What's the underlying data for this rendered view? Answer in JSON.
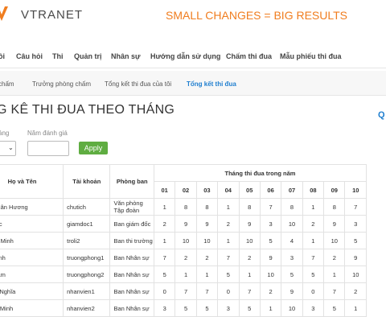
{
  "header": {
    "brand": "VTRANET",
    "slogan": "SMALL CHANGES = BIG RESULTS",
    "logo_color": "#f07d1f"
  },
  "nav": {
    "items": [
      "ồi",
      "Câu hỏi",
      "Thi",
      "Quản trị",
      "Nhân sự",
      "Hướng dẫn sử dụng",
      "Chấm thi đua",
      "Mẫu phiếu thi đua"
    ]
  },
  "subnav": {
    "items": [
      "chấm",
      "Trưởng phòng chấm",
      "Tổng kết thi đua của tôi",
      "Tổng kết thi đua"
    ],
    "active_index": 3,
    "active_color": "#1e7ecf"
  },
  "page": {
    "title": "G KÊ THI ĐUA THEO THÁNG",
    "search_icon": "Q"
  },
  "filters": {
    "month_label": "áng",
    "year_label": "Năm đánh giá",
    "month_select_icon": "chevron-down-icon",
    "year_value": "",
    "apply_label": "Apply",
    "apply_color": "#5fad41"
  },
  "table": {
    "col_name": "Họ và Tên",
    "col_account": "Tài khoản",
    "col_dept": "Phòng ban",
    "col_months_group": "Tháng thi đua trong năm",
    "months": [
      "01",
      "02",
      "03",
      "04",
      "05",
      "06",
      "07",
      "08",
      "09",
      "10"
    ],
    "rows": [
      {
        "name": "ần Xuân Hương",
        "account": "chutich",
        "dept": "Văn phòng Tập đoàn",
        "scores": [
          "1",
          "8",
          "8",
          "1",
          "8",
          "7",
          "8",
          "1",
          "8",
          "7"
        ]
      },
      {
        "name": "ì Ngọc",
        "account": "giamdoc1",
        "dept": "Ban giám đốc",
        "scores": [
          "2",
          "9",
          "9",
          "2",
          "9",
          "3",
          "10",
          "2",
          "9",
          "3"
        ]
      },
      {
        "name": "Ngọc Minh",
        "account": "troli2",
        "dept": "Ban thi trường",
        "scores": [
          "1",
          "10",
          "10",
          "1",
          "10",
          "5",
          "4",
          "1",
          "10",
          "5"
        ]
      },
      {
        "name": "ão Bình",
        "account": "truongphong1",
        "dept": "Ban Nhân sự",
        "scores": [
          "7",
          "2",
          "2",
          "7",
          "2",
          "9",
          "3",
          "7",
          "2",
          "9"
        ]
      },
      {
        "name": "ọc Nam",
        "account": "truongphong2",
        "dept": "Ban Nhân sự",
        "scores": [
          "5",
          "1",
          "1",
          "5",
          "1",
          "10",
          "5",
          "5",
          "1",
          "10"
        ]
      },
      {
        "name": "Minh Nghĩa",
        "account": "nhanvien1",
        "dept": "Ban Nhân sự",
        "scores": [
          "0",
          "7",
          "7",
          "0",
          "7",
          "2",
          "9",
          "0",
          "7",
          "2"
        ]
      },
      {
        "name": "Tuấn Minh",
        "account": "nhanvien2",
        "dept": "Ban Nhân sự",
        "scores": [
          "3",
          "5",
          "5",
          "3",
          "5",
          "1",
          "10",
          "3",
          "5",
          "1"
        ]
      }
    ]
  }
}
